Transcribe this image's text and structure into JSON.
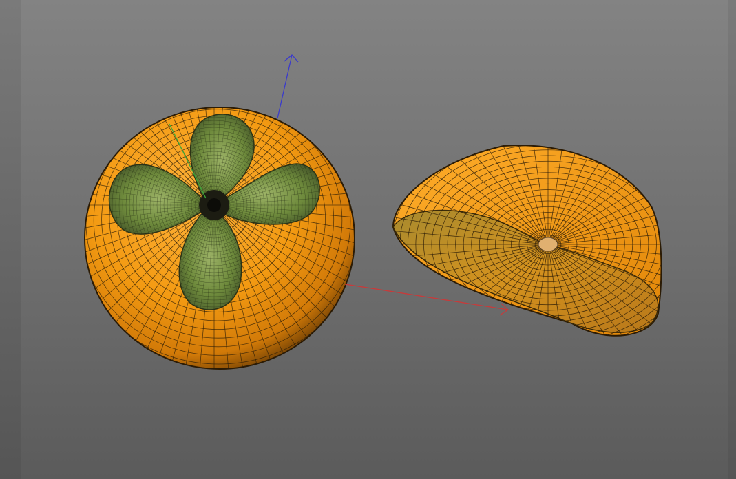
{
  "viewport": {
    "background_top": "#838383",
    "background_bottom": "#5b5b5b"
  },
  "scene": {
    "objects": [
      {
        "name": "whole-persimmon",
        "fruit_color": "#f29a12",
        "calyx_color": "#6f8a3a"
      },
      {
        "name": "half-persimmon",
        "fruit_color": "#f29a12",
        "cut_face_color": "#c88a1e"
      }
    ],
    "axes": {
      "x_color": "#c83a3a",
      "y_color": "#3aa83a",
      "z_color": "#3a3acc"
    },
    "wireframe_color": "#2a1c08"
  }
}
